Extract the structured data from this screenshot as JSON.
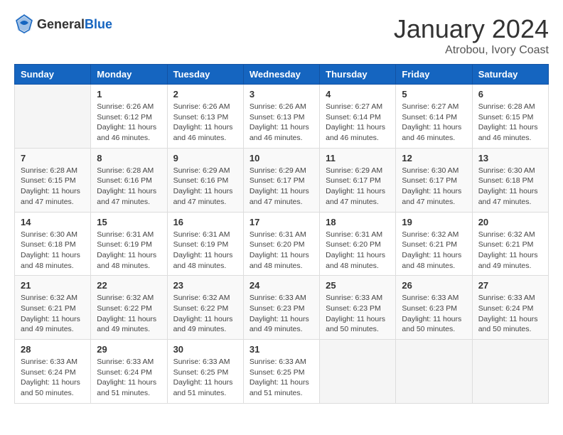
{
  "header": {
    "logo_general": "General",
    "logo_blue": "Blue",
    "month": "January 2024",
    "location": "Atrobou, Ivory Coast"
  },
  "weekdays": [
    "Sunday",
    "Monday",
    "Tuesday",
    "Wednesday",
    "Thursday",
    "Friday",
    "Saturday"
  ],
  "weeks": [
    [
      {
        "day": "",
        "info": ""
      },
      {
        "day": "1",
        "info": "Sunrise: 6:26 AM\nSunset: 6:12 PM\nDaylight: 11 hours and 46 minutes."
      },
      {
        "day": "2",
        "info": "Sunrise: 6:26 AM\nSunset: 6:13 PM\nDaylight: 11 hours and 46 minutes."
      },
      {
        "day": "3",
        "info": "Sunrise: 6:26 AM\nSunset: 6:13 PM\nDaylight: 11 hours and 46 minutes."
      },
      {
        "day": "4",
        "info": "Sunrise: 6:27 AM\nSunset: 6:14 PM\nDaylight: 11 hours and 46 minutes."
      },
      {
        "day": "5",
        "info": "Sunrise: 6:27 AM\nSunset: 6:14 PM\nDaylight: 11 hours and 46 minutes."
      },
      {
        "day": "6",
        "info": "Sunrise: 6:28 AM\nSunset: 6:15 PM\nDaylight: 11 hours and 46 minutes."
      }
    ],
    [
      {
        "day": "7",
        "info": "Sunrise: 6:28 AM\nSunset: 6:15 PM\nDaylight: 11 hours and 47 minutes."
      },
      {
        "day": "8",
        "info": "Sunrise: 6:28 AM\nSunset: 6:16 PM\nDaylight: 11 hours and 47 minutes."
      },
      {
        "day": "9",
        "info": "Sunrise: 6:29 AM\nSunset: 6:16 PM\nDaylight: 11 hours and 47 minutes."
      },
      {
        "day": "10",
        "info": "Sunrise: 6:29 AM\nSunset: 6:17 PM\nDaylight: 11 hours and 47 minutes."
      },
      {
        "day": "11",
        "info": "Sunrise: 6:29 AM\nSunset: 6:17 PM\nDaylight: 11 hours and 47 minutes."
      },
      {
        "day": "12",
        "info": "Sunrise: 6:30 AM\nSunset: 6:17 PM\nDaylight: 11 hours and 47 minutes."
      },
      {
        "day": "13",
        "info": "Sunrise: 6:30 AM\nSunset: 6:18 PM\nDaylight: 11 hours and 47 minutes."
      }
    ],
    [
      {
        "day": "14",
        "info": "Sunrise: 6:30 AM\nSunset: 6:18 PM\nDaylight: 11 hours and 48 minutes."
      },
      {
        "day": "15",
        "info": "Sunrise: 6:31 AM\nSunset: 6:19 PM\nDaylight: 11 hours and 48 minutes."
      },
      {
        "day": "16",
        "info": "Sunrise: 6:31 AM\nSunset: 6:19 PM\nDaylight: 11 hours and 48 minutes."
      },
      {
        "day": "17",
        "info": "Sunrise: 6:31 AM\nSunset: 6:20 PM\nDaylight: 11 hours and 48 minutes."
      },
      {
        "day": "18",
        "info": "Sunrise: 6:31 AM\nSunset: 6:20 PM\nDaylight: 11 hours and 48 minutes."
      },
      {
        "day": "19",
        "info": "Sunrise: 6:32 AM\nSunset: 6:21 PM\nDaylight: 11 hours and 48 minutes."
      },
      {
        "day": "20",
        "info": "Sunrise: 6:32 AM\nSunset: 6:21 PM\nDaylight: 11 hours and 49 minutes."
      }
    ],
    [
      {
        "day": "21",
        "info": "Sunrise: 6:32 AM\nSunset: 6:21 PM\nDaylight: 11 hours and 49 minutes."
      },
      {
        "day": "22",
        "info": "Sunrise: 6:32 AM\nSunset: 6:22 PM\nDaylight: 11 hours and 49 minutes."
      },
      {
        "day": "23",
        "info": "Sunrise: 6:32 AM\nSunset: 6:22 PM\nDaylight: 11 hours and 49 minutes."
      },
      {
        "day": "24",
        "info": "Sunrise: 6:33 AM\nSunset: 6:23 PM\nDaylight: 11 hours and 49 minutes."
      },
      {
        "day": "25",
        "info": "Sunrise: 6:33 AM\nSunset: 6:23 PM\nDaylight: 11 hours and 50 minutes."
      },
      {
        "day": "26",
        "info": "Sunrise: 6:33 AM\nSunset: 6:23 PM\nDaylight: 11 hours and 50 minutes."
      },
      {
        "day": "27",
        "info": "Sunrise: 6:33 AM\nSunset: 6:24 PM\nDaylight: 11 hours and 50 minutes."
      }
    ],
    [
      {
        "day": "28",
        "info": "Sunrise: 6:33 AM\nSunset: 6:24 PM\nDaylight: 11 hours and 50 minutes."
      },
      {
        "day": "29",
        "info": "Sunrise: 6:33 AM\nSunset: 6:24 PM\nDaylight: 11 hours and 51 minutes."
      },
      {
        "day": "30",
        "info": "Sunrise: 6:33 AM\nSunset: 6:25 PM\nDaylight: 11 hours and 51 minutes."
      },
      {
        "day": "31",
        "info": "Sunrise: 6:33 AM\nSunset: 6:25 PM\nDaylight: 11 hours and 51 minutes."
      },
      {
        "day": "",
        "info": ""
      },
      {
        "day": "",
        "info": ""
      },
      {
        "day": "",
        "info": ""
      }
    ]
  ]
}
